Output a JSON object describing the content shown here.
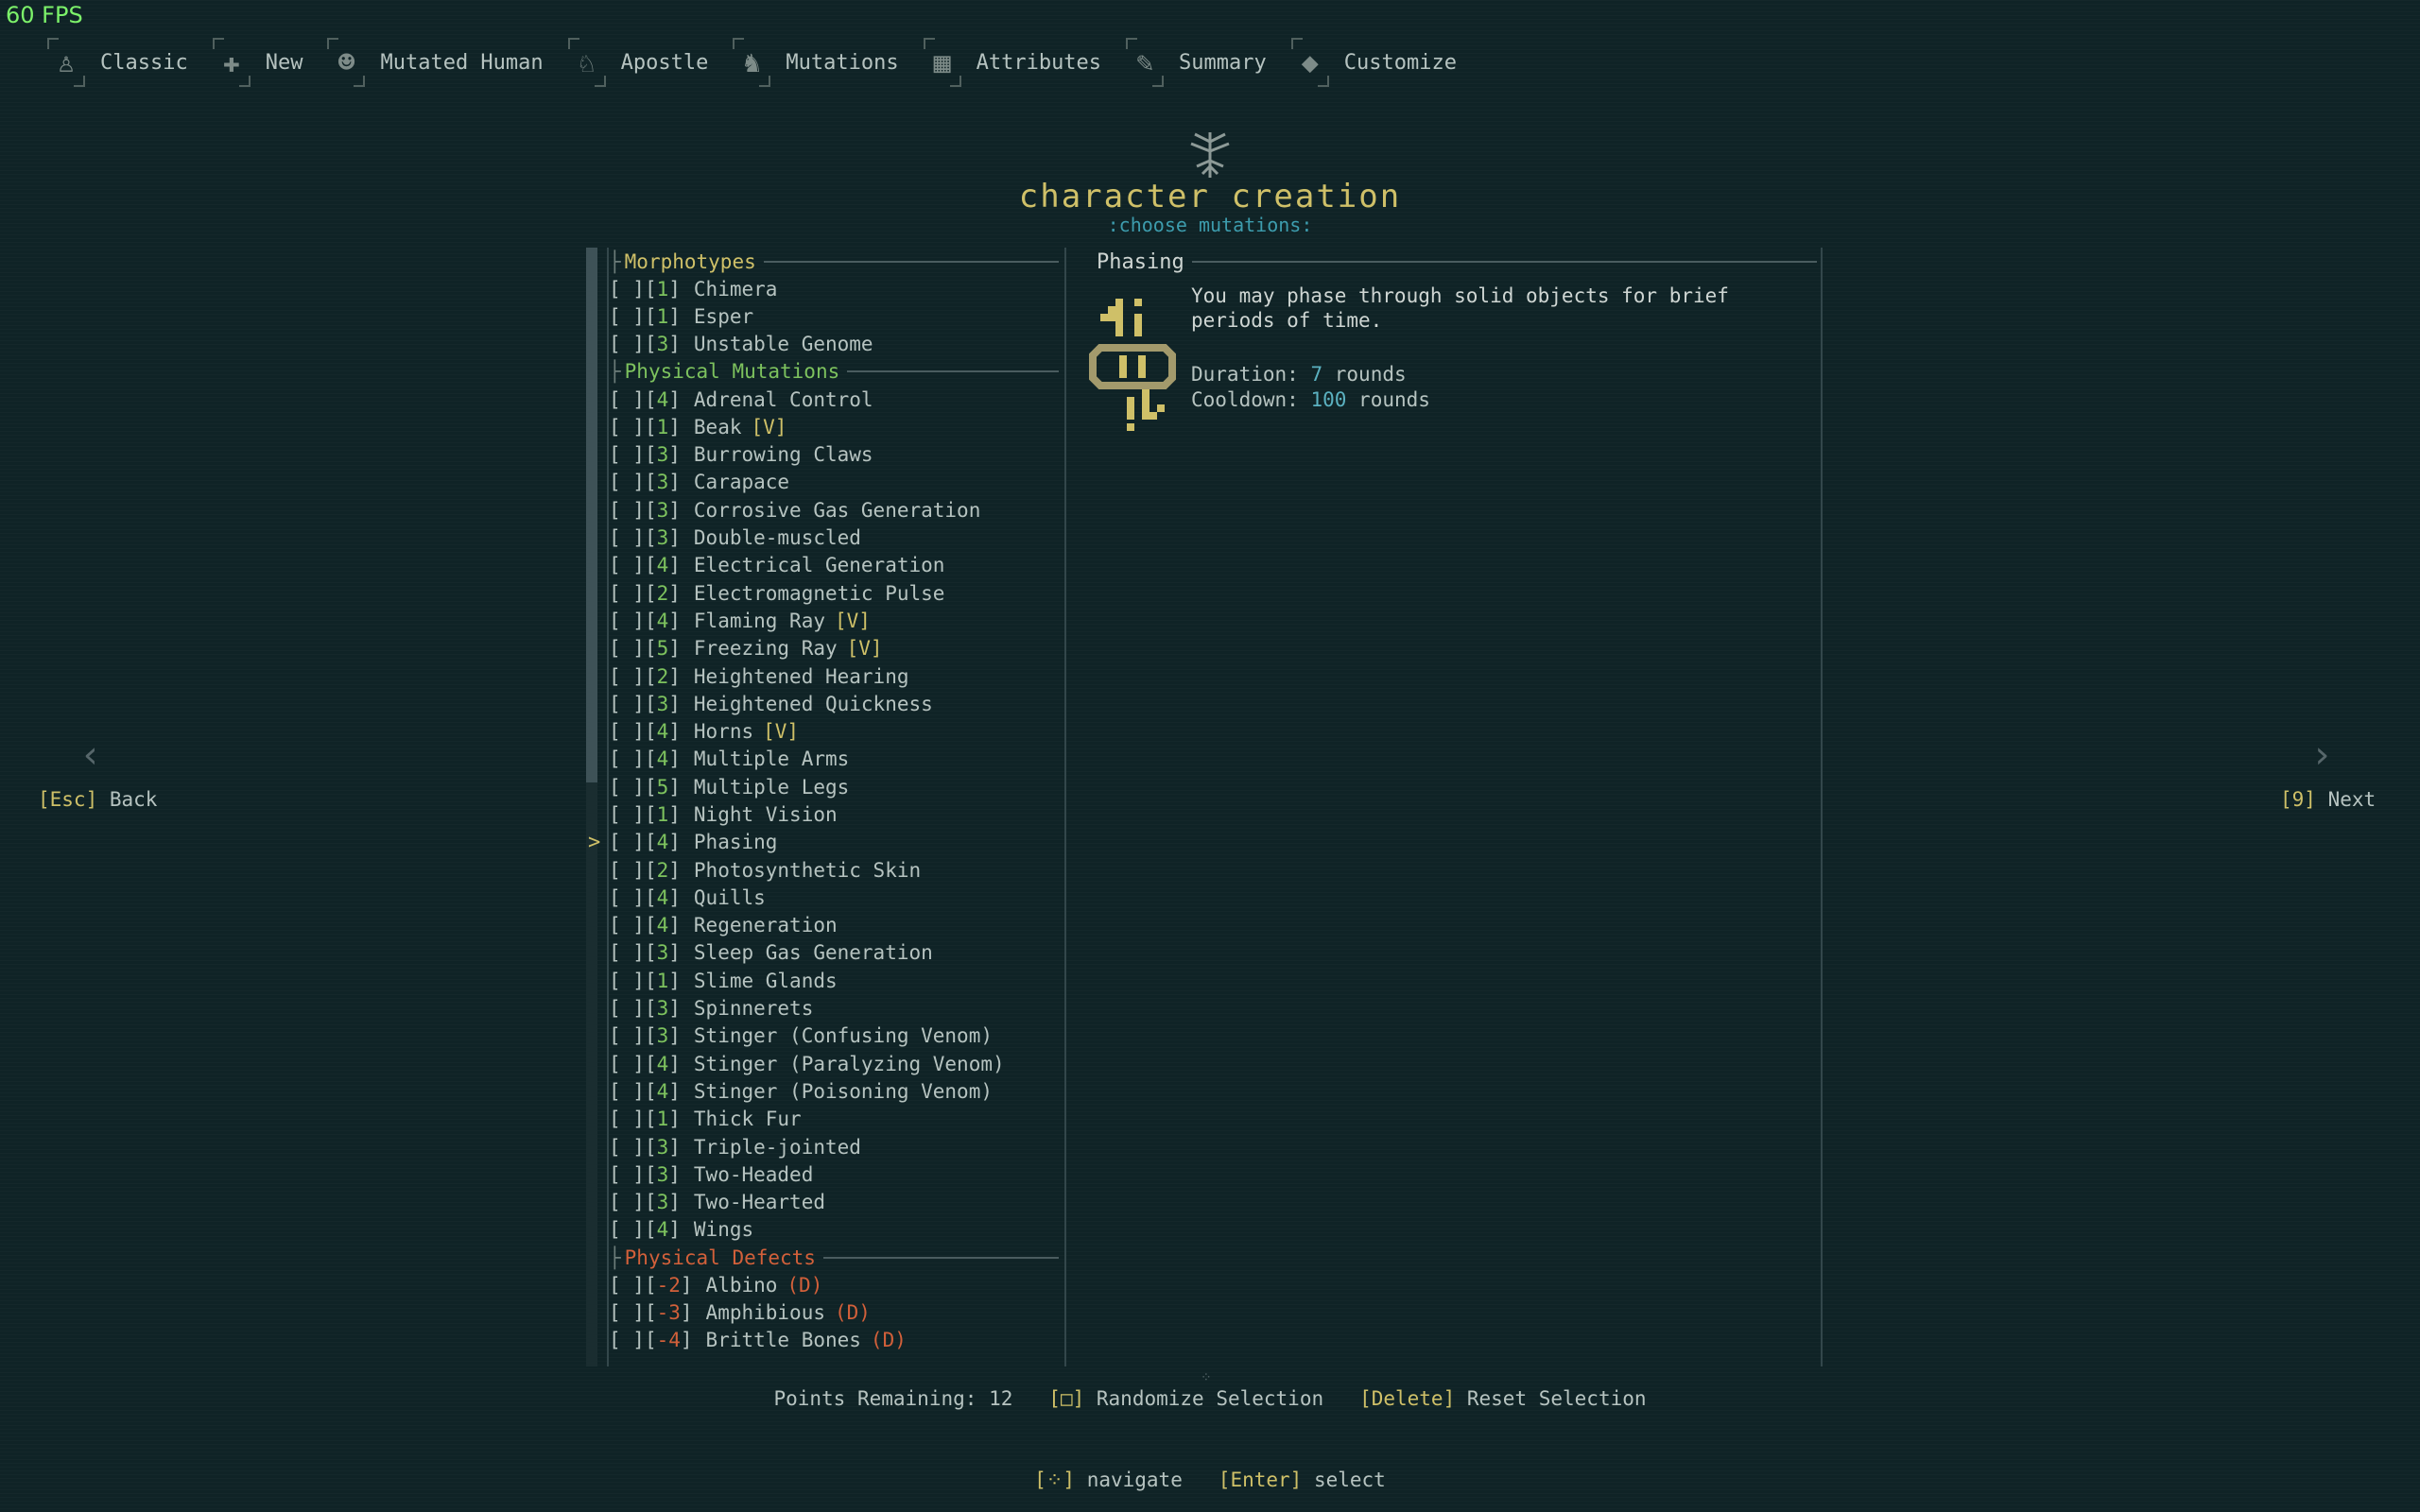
{
  "fps": "60 FPS",
  "tabs": [
    {
      "label": "Classic",
      "icon": "classic-icon",
      "glyph": "♙"
    },
    {
      "label": "New",
      "icon": "plus-icon",
      "glyph": "✚"
    },
    {
      "label": "Mutated Human",
      "icon": "mutated-human-icon",
      "glyph": "☻"
    },
    {
      "label": "Apostle",
      "icon": "apostle-icon",
      "glyph": "♘"
    },
    {
      "label": "Mutations",
      "icon": "mutations-icon",
      "glyph": "♞"
    },
    {
      "label": "Attributes",
      "icon": "attributes-icon",
      "glyph": "▦"
    },
    {
      "label": "Summary",
      "icon": "summary-icon",
      "glyph": "✎"
    },
    {
      "label": "Customize",
      "icon": "customize-icon",
      "glyph": "◆"
    }
  ],
  "header": {
    "title": "character creation",
    "subtitle": ":choose mutations:"
  },
  "colors": {
    "accent": "#cfc068",
    "morphotype": "#cfc068",
    "physical": "#7dc25e",
    "defect": "#d2603a",
    "costPositive": "#7dc25e",
    "costNegative": "#d2603a",
    "value": "#5bb1c0"
  },
  "categories": [
    {
      "name": "Morphotypes",
      "kind": "morphotype",
      "items": [
        {
          "box": "[ ]",
          "cost": "1",
          "name": "Chimera"
        },
        {
          "box": "[ ]",
          "cost": "1",
          "name": "Esper"
        },
        {
          "box": "[ ]",
          "cost": "3",
          "name": "Unstable Genome"
        }
      ]
    },
    {
      "name": "Physical Mutations",
      "kind": "physical",
      "items": [
        {
          "box": "[ ]",
          "cost": "4",
          "name": "Adrenal Control"
        },
        {
          "box": "[ ]",
          "cost": "1",
          "name": "Beak",
          "tag": "[V]"
        },
        {
          "box": "[ ]",
          "cost": "3",
          "name": "Burrowing Claws"
        },
        {
          "box": "[ ]",
          "cost": "3",
          "name": "Carapace"
        },
        {
          "box": "[ ]",
          "cost": "3",
          "name": "Corrosive Gas Generation"
        },
        {
          "box": "[ ]",
          "cost": "3",
          "name": "Double-muscled"
        },
        {
          "box": "[ ]",
          "cost": "4",
          "name": "Electrical Generation"
        },
        {
          "box": "[ ]",
          "cost": "2",
          "name": "Electromagnetic Pulse"
        },
        {
          "box": "[ ]",
          "cost": "4",
          "name": "Flaming Ray",
          "tag": "[V]"
        },
        {
          "box": "[ ]",
          "cost": "5",
          "name": "Freezing Ray",
          "tag": "[V]"
        },
        {
          "box": "[ ]",
          "cost": "2",
          "name": "Heightened Hearing"
        },
        {
          "box": "[ ]",
          "cost": "3",
          "name": "Heightened Quickness"
        },
        {
          "box": "[ ]",
          "cost": "4",
          "name": "Horns",
          "tag": "[V]"
        },
        {
          "box": "[ ]",
          "cost": "4",
          "name": "Multiple Arms"
        },
        {
          "box": "[ ]",
          "cost": "5",
          "name": "Multiple Legs"
        },
        {
          "box": "[ ]",
          "cost": "1",
          "name": "Night Vision"
        },
        {
          "box": "[ ]",
          "cost": "4",
          "name": "Phasing",
          "selected": true
        },
        {
          "box": "[ ]",
          "cost": "2",
          "name": "Photosynthetic Skin"
        },
        {
          "box": "[ ]",
          "cost": "4",
          "name": "Quills"
        },
        {
          "box": "[ ]",
          "cost": "4",
          "name": "Regeneration"
        },
        {
          "box": "[ ]",
          "cost": "3",
          "name": "Sleep Gas Generation"
        },
        {
          "box": "[ ]",
          "cost": "1",
          "name": "Slime Glands"
        },
        {
          "box": "[ ]",
          "cost": "3",
          "name": "Spinnerets"
        },
        {
          "box": "[ ]",
          "cost": "3",
          "name": "Stinger (Confusing Venom)"
        },
        {
          "box": "[ ]",
          "cost": "4",
          "name": "Stinger (Paralyzing Venom)"
        },
        {
          "box": "[ ]",
          "cost": "4",
          "name": "Stinger (Poisoning Venom)"
        },
        {
          "box": "[ ]",
          "cost": "1",
          "name": "Thick Fur"
        },
        {
          "box": "[ ]",
          "cost": "3",
          "name": "Triple-jointed"
        },
        {
          "box": "[ ]",
          "cost": "3",
          "name": "Two-Headed"
        },
        {
          "box": "[ ]",
          "cost": "3",
          "name": "Two-Hearted"
        },
        {
          "box": "[ ]",
          "cost": "4",
          "name": "Wings"
        }
      ]
    },
    {
      "name": "Physical Defects",
      "kind": "defect",
      "items": [
        {
          "box": "[ ]",
          "cost": "-2",
          "name": "Albino",
          "tag": "(D)"
        },
        {
          "box": "[ ]",
          "cost": "-3",
          "name": "Amphibious",
          "tag": "(D)"
        },
        {
          "box": "[ ]",
          "cost": "-4",
          "name": "Brittle Bones",
          "tag": "(D)"
        }
      ]
    }
  ],
  "detail": {
    "title": "Phasing",
    "icon": "phasing-icon",
    "description": "You may phase through solid objects for brief periods of time.",
    "duration_label": "Duration:",
    "duration_value": "7",
    "duration_unit": "rounds",
    "cooldown_label": "Cooldown:",
    "cooldown_value": "100",
    "cooldown_unit": "rounds"
  },
  "nav": {
    "back_key": "[Esc]",
    "back_label": "Back",
    "next_key": "[9]",
    "next_label": "Next"
  },
  "points": {
    "label": "Points Remaining:",
    "value": "12",
    "randomize_key": "[□]",
    "randomize_label": "Randomize Selection",
    "reset_key": "[Delete]",
    "reset_label": "Reset Selection"
  },
  "hint": {
    "navigate_key": "[⁘]",
    "navigate_label": "navigate",
    "select_key": "[Enter]",
    "select_label": "select"
  }
}
